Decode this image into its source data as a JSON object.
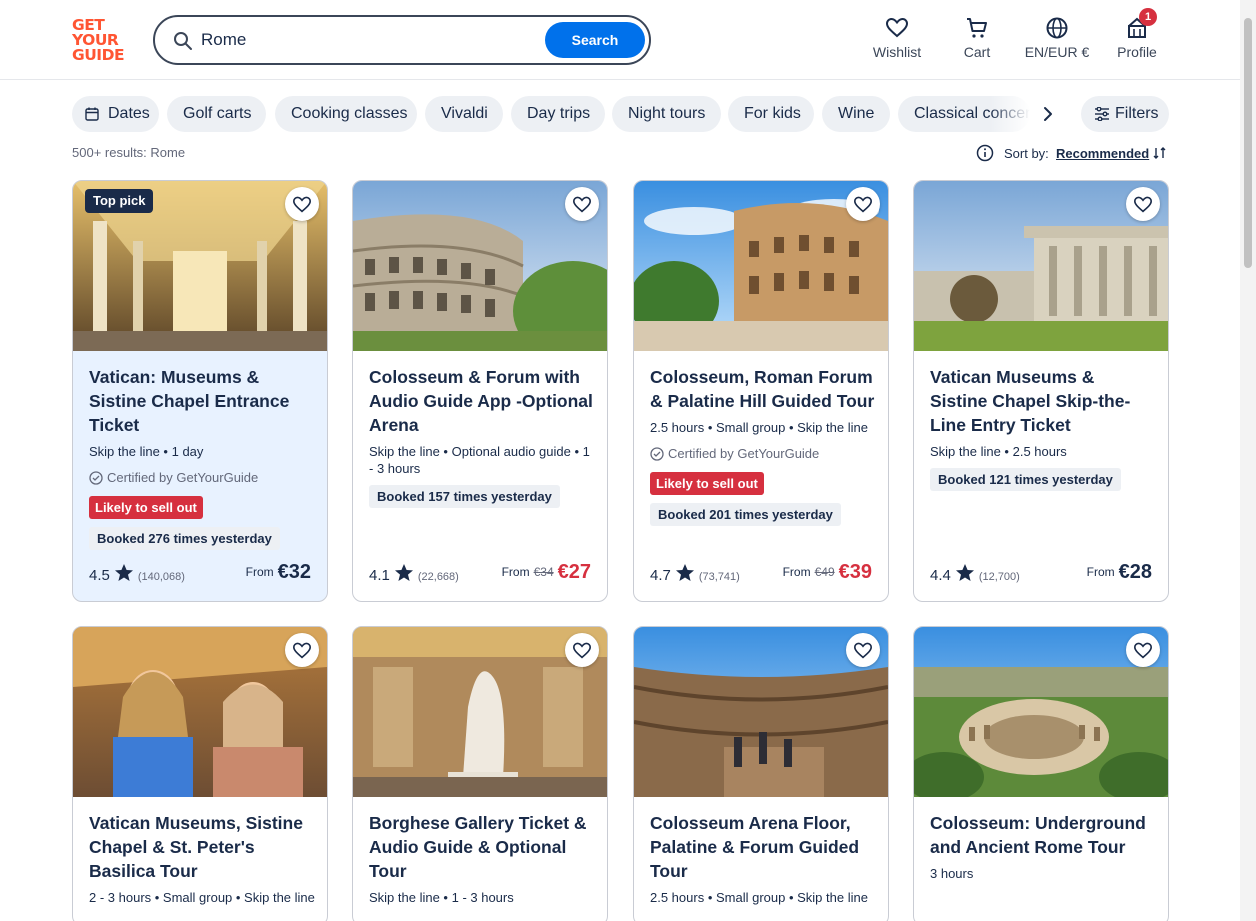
{
  "header": {
    "logo": [
      "GET",
      "YOUR",
      "GUIDE"
    ],
    "search_value": "Rome",
    "search_button": "Search",
    "nav": {
      "wishlist": "Wishlist",
      "cart": "Cart",
      "language": "EN/EUR €",
      "profile": "Profile",
      "profile_badge": "1"
    }
  },
  "chips": [
    "Dates",
    "Golf carts",
    "Cooking classes",
    "Vivaldi",
    "Day trips",
    "Night tours",
    "For kids",
    "Wine",
    "Classical concerts"
  ],
  "filters_label": "Filters",
  "results_text": "500+ results: Rome",
  "sort": {
    "label": "Sort by:",
    "value": "Recommended"
  },
  "cards": [
    {
      "badge": "Top pick",
      "title": "Vatican: Museums & Sistine Chapel Entrance Ticket",
      "meta": "Skip the line • 1 day",
      "certified": "Certified by GetYourGuide",
      "sellout": "Likely to sell out",
      "booked": "Booked 276 times yesterday",
      "rating": "4.5",
      "reviews": "(140,068)",
      "from": "From",
      "old_price": "",
      "price": "€32"
    },
    {
      "title": "Colosseum & Forum with Audio Guide App -Optional Arena",
      "meta": "Skip the line • Optional audio guide • 1 - 3 hours",
      "booked": "Booked 157 times yesterday",
      "rating": "4.1",
      "reviews": "(22,668)",
      "from": "From",
      "old_price": "€34",
      "price": "€27"
    },
    {
      "title": "Colosseum, Roman Forum & Palatine Hill Guided Tour",
      "meta": "2.5 hours • Small group • Skip the line",
      "certified": "Certified by GetYourGuide",
      "sellout": "Likely to sell out",
      "booked": "Booked 201 times yesterday",
      "rating": "4.7",
      "reviews": "(73,741)",
      "from": "From",
      "old_price": "€49",
      "price": "€39"
    },
    {
      "title": "Vatican Museums & Sistine Chapel Skip-the-Line Entry Ticket",
      "meta": "Skip the line • 2.5 hours",
      "booked": "Booked 121 times yesterday",
      "rating": "4.4",
      "reviews": "(12,700)",
      "from": "From",
      "old_price": "",
      "price": "€28"
    },
    {
      "title": "Vatican Museums, Sistine Chapel & St. Peter's Basilica Tour",
      "meta": "2 - 3 hours • Small group • Skip the line"
    },
    {
      "title": "Borghese Gallery Ticket & Audio Guide & Optional Tour",
      "meta": "Skip the line • 1 - 3 hours"
    },
    {
      "title": "Colosseum Arena Floor, Palatine & Forum Guided Tour",
      "meta": "2.5 hours • Small group • Skip the line"
    },
    {
      "title": "Colosseum: Underground and Ancient Rome Tour",
      "meta": "3 hours"
    }
  ]
}
